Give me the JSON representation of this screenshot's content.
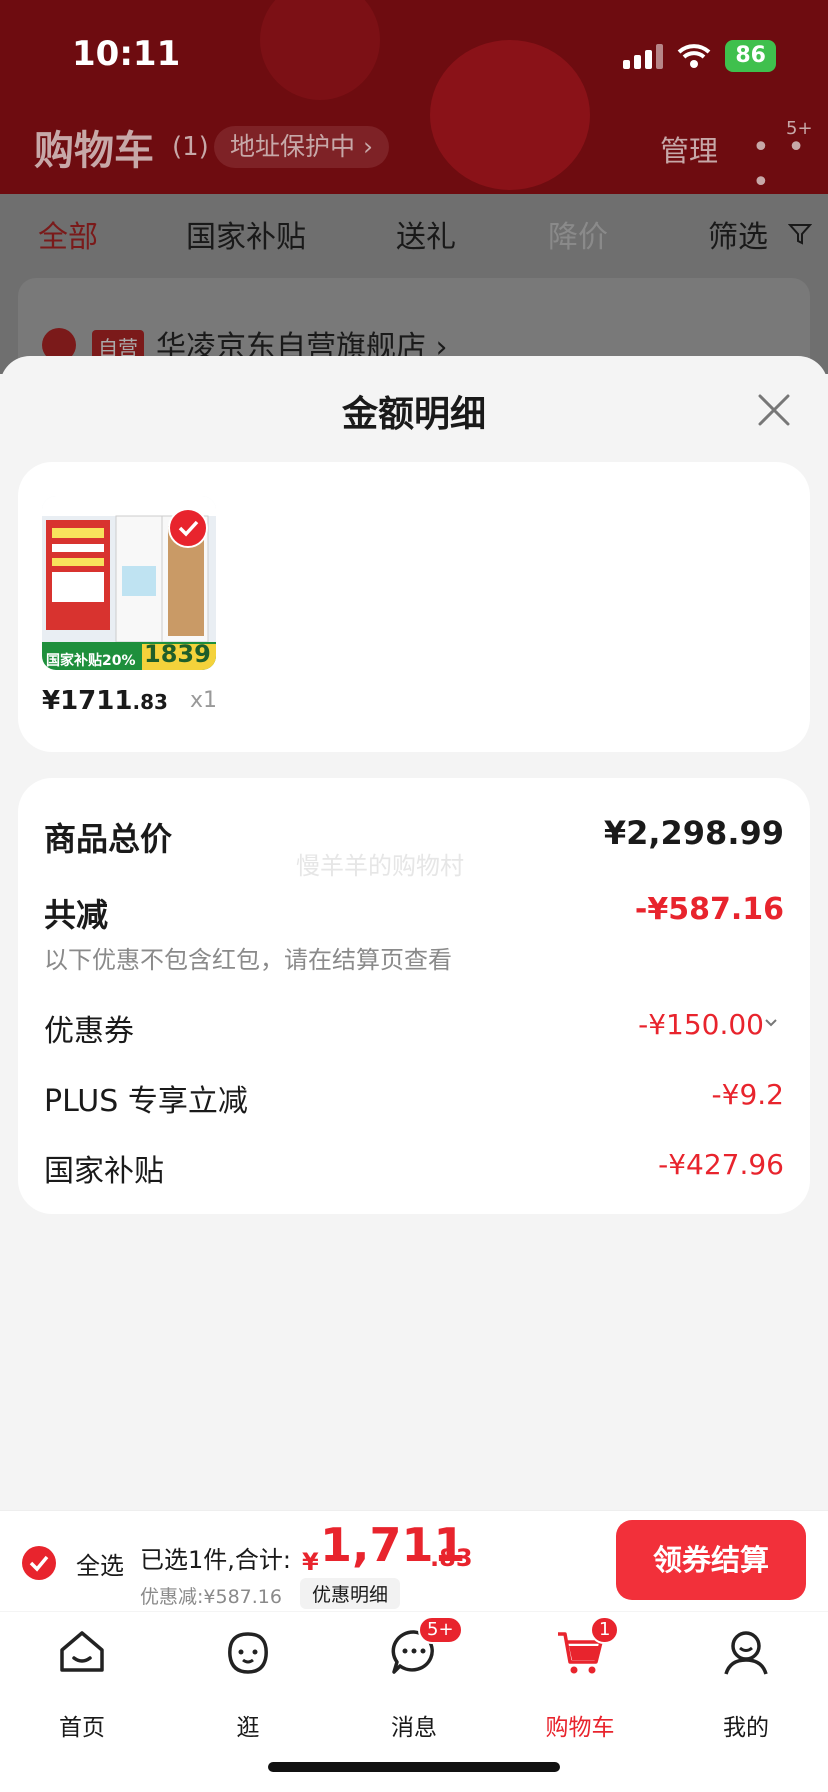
{
  "status_bar": {
    "time": "10:11",
    "battery": "86"
  },
  "header": {
    "title": "购物车",
    "count": "(1)",
    "address_pill": "地址保护中 ›",
    "manage": "管理",
    "more": "• • •",
    "more_badge": "5+"
  },
  "filters": [
    "全部",
    "国家补贴",
    "送礼",
    "降价",
    "筛选"
  ],
  "store": {
    "tag": "自营",
    "name": "华凌京东自营旗舰店 ›"
  },
  "sheet": {
    "title": "金额明细",
    "item": {
      "price_main": "¥1711",
      "price_dec": ".83",
      "qty": "x1",
      "image_price": "1839",
      "image_subsidy": "国家补贴20%"
    },
    "total_label": "商品总价",
    "total_value": "¥2,298.99",
    "reduce_label": "共减",
    "reduce_value": "-¥587.16",
    "note": "以下优惠不包含红包，请在结算页查看",
    "watermark": "慢羊羊的购物村",
    "rows": [
      {
        "label": "优惠券",
        "value": "-¥150.00"
      },
      {
        "label": "PLUS 专享立减",
        "value": "-¥9.2"
      },
      {
        "label": "国家补贴",
        "value": "-¥427.96"
      }
    ]
  },
  "bottom_bar": {
    "select_all": "全选",
    "picked": "已选1件,合计:",
    "currency": "¥",
    "total_int": "1,711",
    "total_dec": ".83",
    "saved": "优惠减:¥587.16",
    "detail": "优惠明细",
    "checkout": "领券结算"
  },
  "tabs": [
    {
      "label": "首页",
      "icon": "home-icon"
    },
    {
      "label": "逛",
      "icon": "face-icon"
    },
    {
      "label": "消息",
      "icon": "message-icon",
      "badge": "5+"
    },
    {
      "label": "购物车",
      "icon": "cart-icon",
      "badge": "1",
      "active": true
    },
    {
      "label": "我的",
      "icon": "profile-icon"
    }
  ],
  "colors": {
    "accent": "#e8242d",
    "header": "#6e0c10",
    "checkout": "#f2303a"
  }
}
